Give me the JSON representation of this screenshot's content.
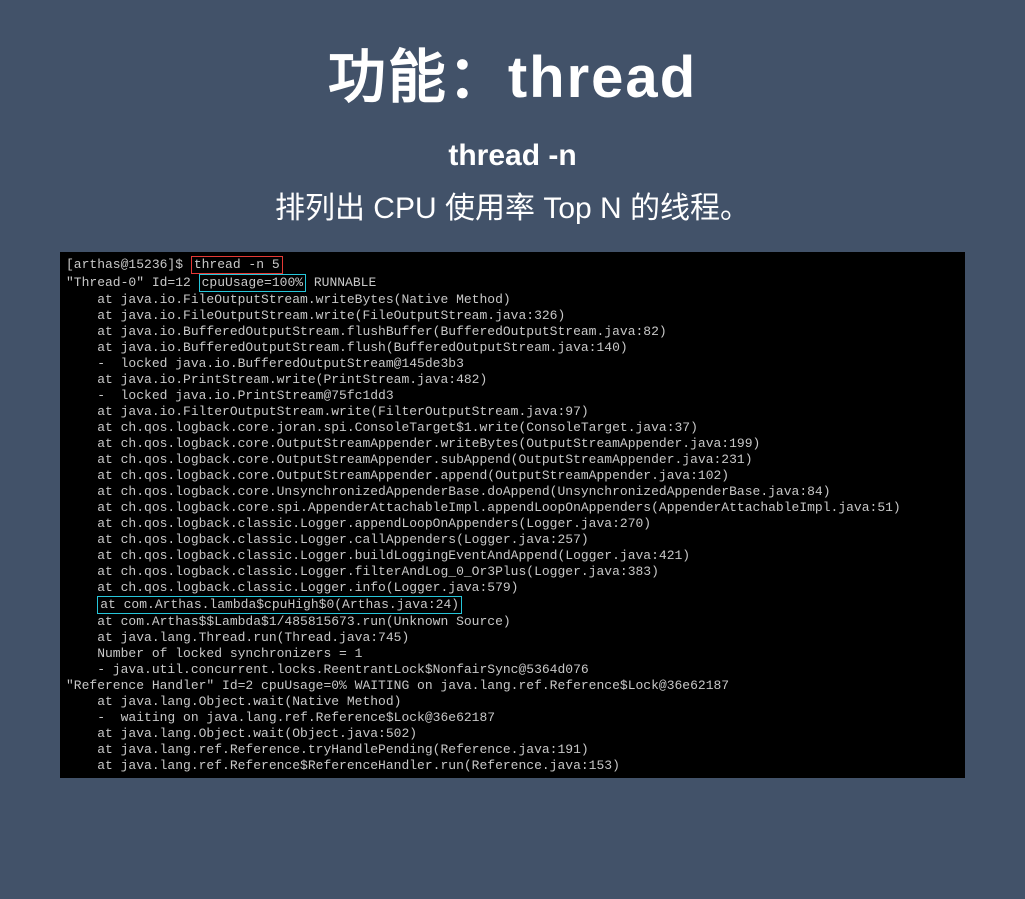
{
  "title": "功能：thread",
  "subtitle": "thread -n",
  "desc": "排列出 CPU 使用率 Top N 的线程。",
  "terminal": {
    "prompt": "[arthas@15236]$ ",
    "command": "thread -n 5",
    "thread0_pre": "\"Thread-0\" Id=12 ",
    "cpu_usage": "cpuUsage=100%",
    "thread0_post": " RUNNABLE",
    "stack1": [
      "    at java.io.FileOutputStream.writeBytes(Native Method)",
      "    at java.io.FileOutputStream.write(FileOutputStream.java:326)",
      "    at java.io.BufferedOutputStream.flushBuffer(BufferedOutputStream.java:82)",
      "    at java.io.BufferedOutputStream.flush(BufferedOutputStream.java:140)",
      "    -  locked java.io.BufferedOutputStream@145de3b3",
      "    at java.io.PrintStream.write(PrintStream.java:482)",
      "    -  locked java.io.PrintStream@75fc1dd3",
      "    at java.io.FilterOutputStream.write(FilterOutputStream.java:97)",
      "    at ch.qos.logback.core.joran.spi.ConsoleTarget$1.write(ConsoleTarget.java:37)",
      "    at ch.qos.logback.core.OutputStreamAppender.writeBytes(OutputStreamAppender.java:199)",
      "    at ch.qos.logback.core.OutputStreamAppender.subAppend(OutputStreamAppender.java:231)",
      "    at ch.qos.logback.core.OutputStreamAppender.append(OutputStreamAppender.java:102)",
      "    at ch.qos.logback.core.UnsynchronizedAppenderBase.doAppend(UnsynchronizedAppenderBase.java:84)",
      "    at ch.qos.logback.core.spi.AppenderAttachableImpl.appendLoopOnAppenders(AppenderAttachableImpl.java:51)",
      "    at ch.qos.logback.classic.Logger.appendLoopOnAppenders(Logger.java:270)",
      "    at ch.qos.logback.classic.Logger.callAppenders(Logger.java:257)",
      "    at ch.qos.logback.classic.Logger.buildLoggingEventAndAppend(Logger.java:421)",
      "    at ch.qos.logback.classic.Logger.filterAndLog_0_Or3Plus(Logger.java:383)",
      "    at ch.qos.logback.classic.Logger.info(Logger.java:579)"
    ],
    "highlight_line_pre": "    ",
    "highlight_line": "at com.Arthas.lambda$cpuHigh$0(Arthas.java:24)",
    "stack2": [
      "    at com.Arthas$$Lambda$1/485815673.run(Unknown Source)",
      "    at java.lang.Thread.run(Thread.java:745)",
      "",
      "    Number of locked synchronizers = 1",
      "    - java.util.concurrent.locks.ReentrantLock$NonfairSync@5364d076",
      "",
      "",
      "\"Reference Handler\" Id=2 cpuUsage=0% WAITING on java.lang.ref.Reference$Lock@36e62187",
      "    at java.lang.Object.wait(Native Method)",
      "    -  waiting on java.lang.ref.Reference$Lock@36e62187",
      "    at java.lang.Object.wait(Object.java:502)",
      "    at java.lang.ref.Reference.tryHandlePending(Reference.java:191)",
      "    at java.lang.ref.Reference$ReferenceHandler.run(Reference.java:153)"
    ]
  }
}
